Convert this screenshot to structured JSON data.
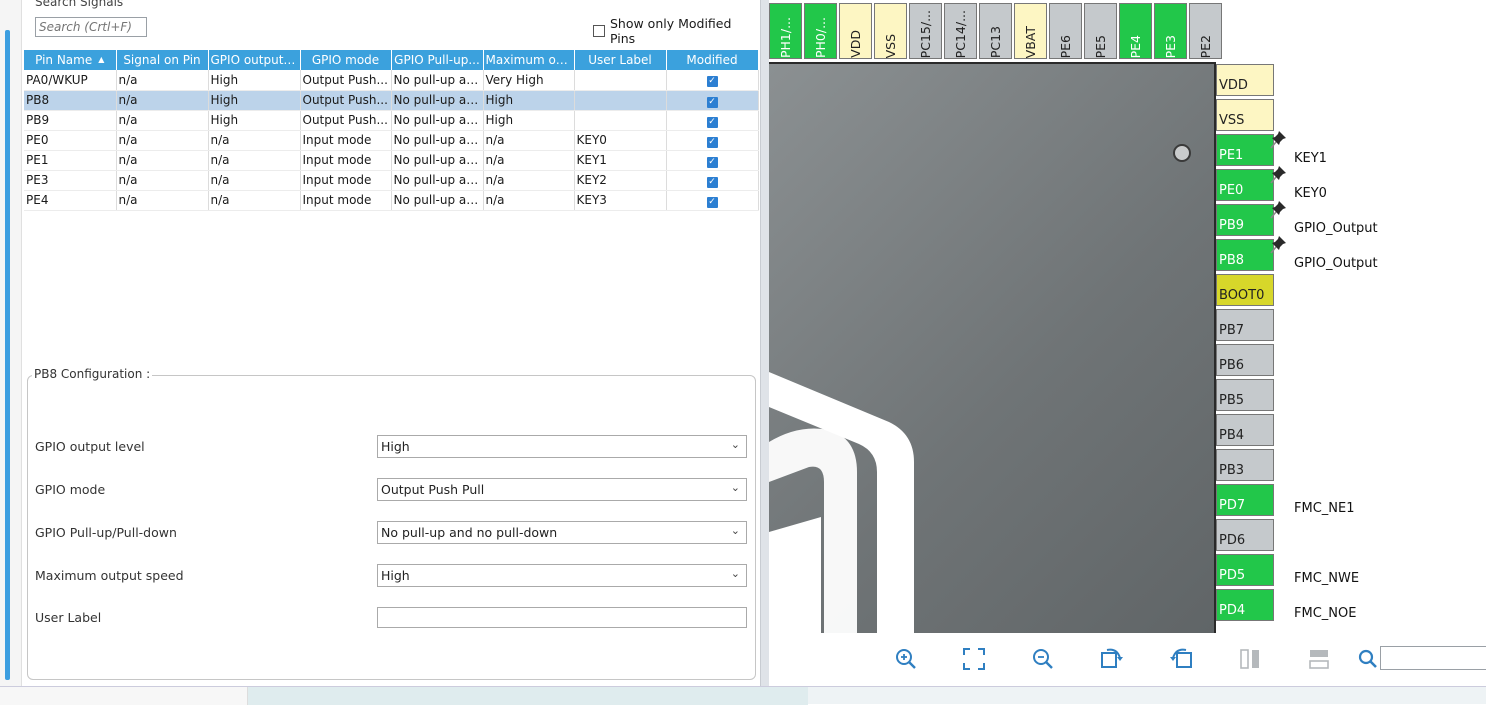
{
  "search": {
    "title": "Search Signals",
    "placeholder": "Search (Crtl+F)",
    "show_modified_label": "Show only Modified Pins"
  },
  "table": {
    "columns": [
      "Pin Name",
      "Signal on Pin",
      "GPIO output ...",
      "GPIO mode",
      "GPIO Pull-up...",
      "Maximum ou...",
      "User Label",
      "Modified"
    ],
    "rows": [
      {
        "pin": "PA0/WKUP",
        "signal": "n/a",
        "output": "High",
        "mode": "Output Push...",
        "pull": "No pull-up an...",
        "speed": "Very High",
        "label": "",
        "modified": true
      },
      {
        "pin": "PB8",
        "signal": "n/a",
        "output": "High",
        "mode": "Output Push...",
        "pull": "No pull-up an...",
        "speed": "High",
        "label": "",
        "modified": true,
        "selected": true
      },
      {
        "pin": "PB9",
        "signal": "n/a",
        "output": "High",
        "mode": "Output Push...",
        "pull": "No pull-up an...",
        "speed": "High",
        "label": "",
        "modified": true
      },
      {
        "pin": "PE0",
        "signal": "n/a",
        "output": "n/a",
        "mode": "Input mode",
        "pull": "No pull-up an...",
        "speed": "n/a",
        "label": "KEY0",
        "modified": true
      },
      {
        "pin": "PE1",
        "signal": "n/a",
        "output": "n/a",
        "mode": "Input mode",
        "pull": "No pull-up an...",
        "speed": "n/a",
        "label": "KEY1",
        "modified": true
      },
      {
        "pin": "PE3",
        "signal": "n/a",
        "output": "n/a",
        "mode": "Input mode",
        "pull": "No pull-up an...",
        "speed": "n/a",
        "label": "KEY2",
        "modified": true
      },
      {
        "pin": "PE4",
        "signal": "n/a",
        "output": "n/a",
        "mode": "Input mode",
        "pull": "No pull-up an...",
        "speed": "n/a",
        "label": "KEY3",
        "modified": true
      }
    ]
  },
  "config": {
    "title": "PB8 Configuration :",
    "fields": [
      {
        "label": "GPIO output level",
        "value": "High"
      },
      {
        "label": "GPIO mode",
        "value": "Output Push Pull"
      },
      {
        "label": "GPIO Pull-up/Pull-down",
        "value": "No pull-up and no pull-down"
      },
      {
        "label": "Maximum output speed",
        "value": "High"
      },
      {
        "label": "User Label",
        "value": ""
      }
    ]
  },
  "chip": {
    "top_pins": [
      {
        "name": "PH1/...",
        "color": "green"
      },
      {
        "name": "PH0/...",
        "color": "green"
      },
      {
        "name": "VDD",
        "color": "yellow"
      },
      {
        "name": "VSS",
        "color": "yellow"
      },
      {
        "name": "PC15/...",
        "color": "gray"
      },
      {
        "name": "PC14/...",
        "color": "gray"
      },
      {
        "name": "PC13",
        "color": "gray"
      },
      {
        "name": "VBAT",
        "color": "yellow"
      },
      {
        "name": "PE6",
        "color": "gray"
      },
      {
        "name": "PE5",
        "color": "gray"
      },
      {
        "name": "PE4",
        "color": "green"
      },
      {
        "name": "PE3",
        "color": "green"
      },
      {
        "name": "PE2",
        "color": "gray"
      }
    ],
    "side_pins": [
      {
        "name": "VDD",
        "color": "yellow",
        "label": "",
        "pinned": false
      },
      {
        "name": "VSS",
        "color": "yellow",
        "label": "",
        "pinned": false
      },
      {
        "name": "PE1",
        "color": "green",
        "label": "KEY1",
        "pinned": true
      },
      {
        "name": "PE0",
        "color": "green",
        "label": "KEY0",
        "pinned": true
      },
      {
        "name": "PB9",
        "color": "green",
        "label": "GPIO_Output",
        "pinned": true
      },
      {
        "name": "PB8",
        "color": "green",
        "label": "GPIO_Output",
        "pinned": true
      },
      {
        "name": "BOOT0",
        "color": "olive",
        "label": "",
        "pinned": false
      },
      {
        "name": "PB7",
        "color": "gray",
        "label": "",
        "pinned": false
      },
      {
        "name": "PB6",
        "color": "gray",
        "label": "",
        "pinned": false
      },
      {
        "name": "PB5",
        "color": "gray",
        "label": "",
        "pinned": false
      },
      {
        "name": "PB4",
        "color": "gray",
        "label": "",
        "pinned": false
      },
      {
        "name": "PB3",
        "color": "gray",
        "label": "",
        "pinned": false
      },
      {
        "name": "PD7",
        "color": "green",
        "label": "FMC_NE1",
        "pinned": false
      },
      {
        "name": "PD6",
        "color": "gray",
        "label": "",
        "pinned": false
      },
      {
        "name": "PD5",
        "color": "green",
        "label": "FMC_NWE",
        "pinned": false
      },
      {
        "name": "PD4",
        "color": "green",
        "label": "FMC_NOE",
        "pinned": false
      }
    ]
  },
  "toolbar": {
    "icons": [
      "zoom-in-icon",
      "fit-screen-icon",
      "zoom-out-icon",
      "rotate-right-icon",
      "rotate-left-icon",
      "vertical-split-icon",
      "horizontal-split-icon",
      "search-icon"
    ]
  },
  "colors": {
    "header_blue": "#3ba1dd",
    "pin_green": "#22c74a",
    "pin_yellow": "#fdf6c3",
    "pin_gray": "#c5c9cc",
    "pin_olive": "#d7d72a",
    "icon_blue": "#2f7fc1"
  }
}
